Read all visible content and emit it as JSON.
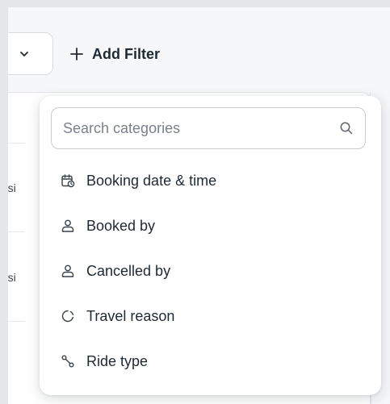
{
  "toolbar": {
    "add_filter_label": "Add Filter"
  },
  "background_table": {
    "row_cells": [
      "ansi",
      "ansi"
    ]
  },
  "category_menu": {
    "search": {
      "placeholder": "Search categories",
      "value": ""
    },
    "items": [
      {
        "label": "Booking date & time",
        "icon": "calendar-clock-icon"
      },
      {
        "label": "Booked by",
        "icon": "user-icon"
      },
      {
        "label": "Cancelled by",
        "icon": "user-icon"
      },
      {
        "label": "Travel reason",
        "icon": "circle-dashed-icon"
      },
      {
        "label": "Ride type",
        "icon": "route-icon"
      }
    ]
  },
  "colors": {
    "canvas_bg": "#f6f7f9",
    "text": "#1f2933",
    "placeholder": "#7b8089",
    "border": "#c9ccd1"
  }
}
